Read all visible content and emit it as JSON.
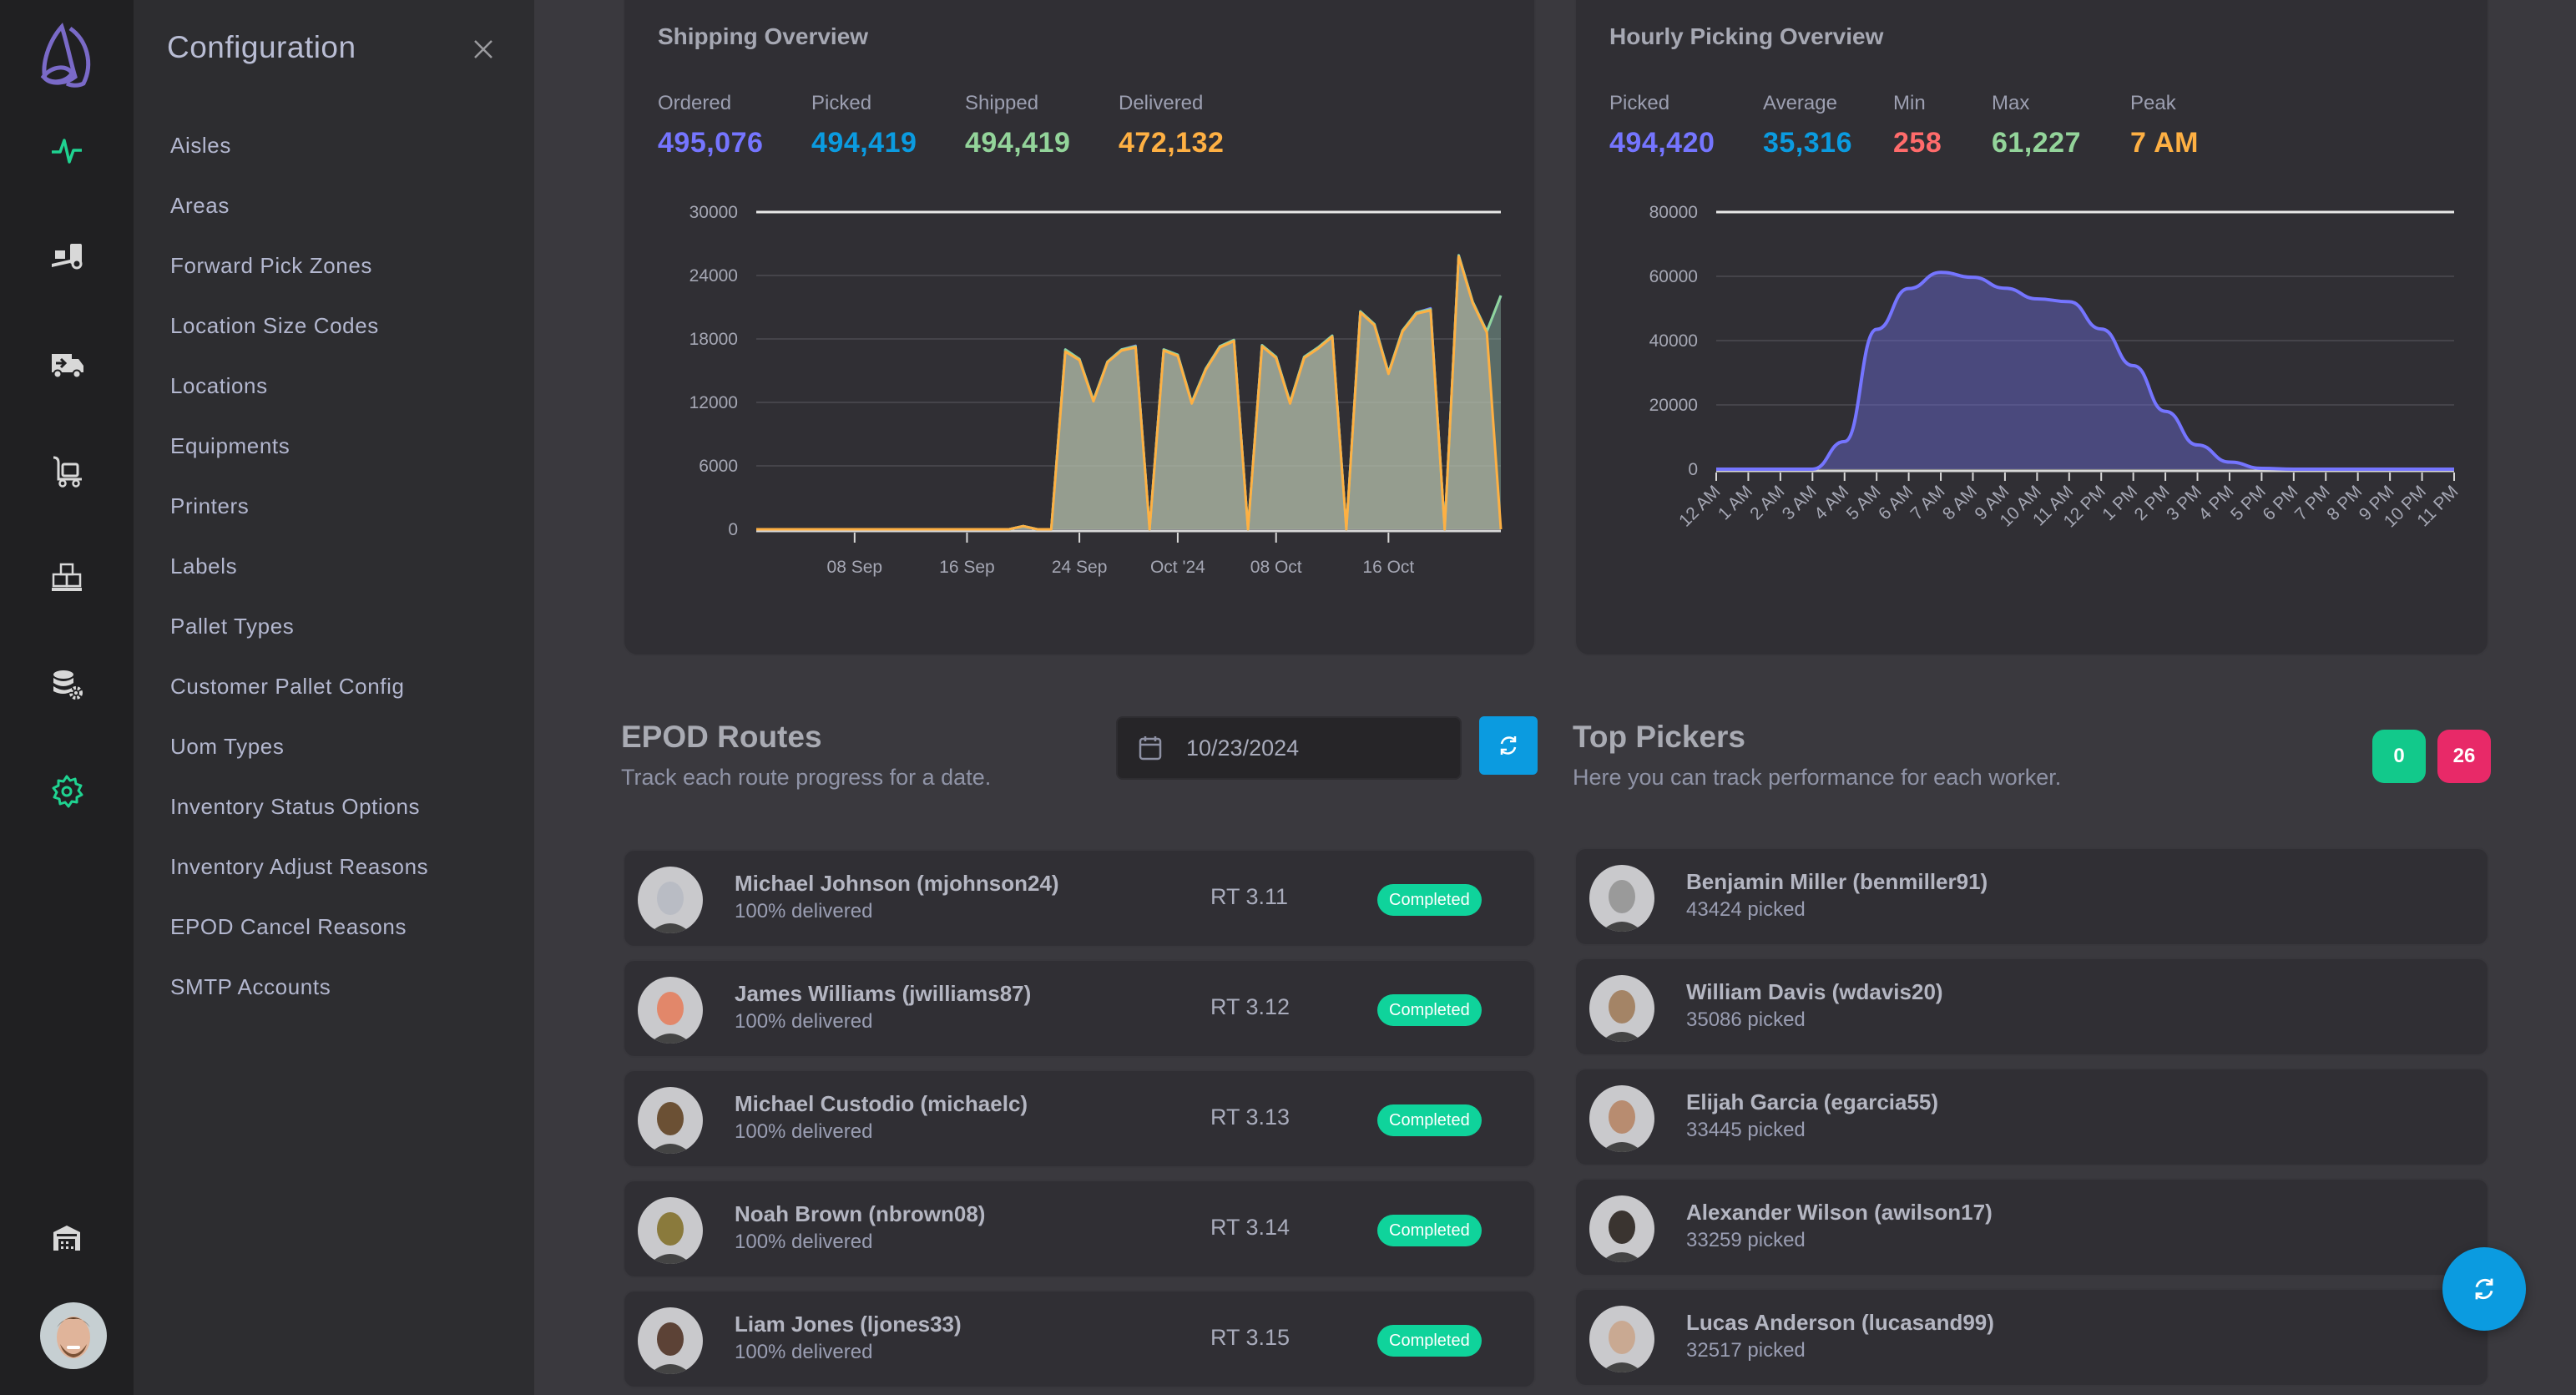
{
  "rail": {
    "items": [
      {
        "name": "dashboard",
        "icon": "activity-icon",
        "active": true
      },
      {
        "name": "receiving",
        "icon": "forklift-icon",
        "active": false
      },
      {
        "name": "shipping",
        "icon": "truck-icon",
        "active": false
      },
      {
        "name": "picking",
        "icon": "hand-cart-icon",
        "active": false
      },
      {
        "name": "inventory",
        "icon": "pallet-boxes-icon",
        "active": false
      },
      {
        "name": "data-settings",
        "icon": "database-gear-icon",
        "active": false
      },
      {
        "name": "configuration",
        "icon": "gear-icon",
        "active": true
      }
    ],
    "bottom": [
      {
        "name": "warehouse",
        "icon": "warehouse-icon"
      }
    ],
    "active_color": "#1fd391",
    "icon_color": "#d8d8d8"
  },
  "config": {
    "title": "Configuration",
    "items": [
      "Aisles",
      "Areas",
      "Forward Pick Zones",
      "Location Size Codes",
      "Locations",
      "Equipments",
      "Printers",
      "Labels",
      "Pallet Types",
      "Customer Pallet Config",
      "Uom Types",
      "Inventory Status Options",
      "Inventory Adjust Reasons",
      "EPOD Cancel Reasons",
      "SMTP Accounts"
    ]
  },
  "shipping": {
    "title": "Shipping Overview",
    "stats": [
      {
        "label": "Ordered",
        "value": "495,076",
        "color": "#7575ff"
      },
      {
        "label": "Picked",
        "value": "494,419",
        "color": "#0b9be0"
      },
      {
        "label": "Shipped",
        "value": "494,419",
        "color": "#93d49a"
      },
      {
        "label": "Delivered",
        "value": "472,132",
        "color": "#feb043"
      }
    ]
  },
  "hourly": {
    "title": "Hourly Picking Overview",
    "stats": [
      {
        "label": "Picked",
        "value": "494,420",
        "color": "#7575ff"
      },
      {
        "label": "Average",
        "value": "35,316",
        "color": "#0b9be0"
      },
      {
        "label": "Min",
        "value": "258",
        "color": "#ff6b6b"
      },
      {
        "label": "Max",
        "value": "61,227",
        "color": "#93d49a"
      },
      {
        "label": "Peak",
        "value": "7 AM",
        "color": "#feb043"
      }
    ]
  },
  "chart_data": [
    {
      "type": "area",
      "title": "Shipping Overview",
      "xlabel": "",
      "ylabel": "",
      "x_start": "2024-09-01",
      "x_end": "2024-10-24",
      "x_tick_labels": [
        "08 Sep",
        "16 Sep",
        "24 Sep",
        "Oct '24",
        "08 Oct",
        "16 Oct"
      ],
      "x_tick_days": [
        7,
        15,
        23,
        30,
        37,
        45
      ],
      "ylim": [
        0,
        30000
      ],
      "y_ticks": [
        0,
        6000,
        12000,
        18000,
        24000,
        30000
      ],
      "grid": true,
      "legend": "none",
      "series": [
        {
          "name": "Ordered",
          "color": "#7575ff",
          "values": [
            0,
            0,
            0,
            0,
            0,
            0,
            0,
            0,
            0,
            0,
            0,
            0,
            0,
            0,
            0,
            0,
            0,
            0,
            0,
            300,
            0,
            0,
            17000,
            16100,
            12200,
            15850,
            17000,
            17350,
            0,
            17000,
            16500,
            12000,
            15200,
            17300,
            17900,
            0,
            17400,
            16300,
            12000,
            16300,
            17200,
            18300,
            0,
            20600,
            19400,
            14800,
            18800,
            20500,
            20900,
            0,
            25900,
            21500,
            18700,
            22100
          ]
        },
        {
          "name": "Picked",
          "color": "#0b9be0",
          "values": [
            0,
            0,
            0,
            0,
            0,
            0,
            0,
            0,
            0,
            0,
            0,
            0,
            0,
            0,
            0,
            0,
            0,
            0,
            0,
            300,
            0,
            0,
            17000,
            16100,
            12200,
            15850,
            17000,
            17300,
            0,
            17000,
            16500,
            12000,
            15200,
            17300,
            17900,
            0,
            17400,
            16300,
            12000,
            16300,
            17200,
            18300,
            0,
            20600,
            19400,
            14800,
            18800,
            20500,
            20800,
            0,
            25900,
            21500,
            18700,
            22100
          ]
        },
        {
          "name": "Shipped",
          "color": "#93d49a",
          "values": [
            0,
            0,
            0,
            0,
            0,
            0,
            0,
            0,
            0,
            0,
            0,
            0,
            0,
            0,
            0,
            0,
            0,
            0,
            0,
            300,
            0,
            0,
            17000,
            16100,
            12200,
            15850,
            17000,
            17300,
            0,
            17000,
            16500,
            12000,
            15200,
            17300,
            17900,
            0,
            17400,
            16300,
            12000,
            16300,
            17200,
            18300,
            0,
            20600,
            19400,
            14800,
            18800,
            20500,
            20800,
            0,
            25900,
            21500,
            18700,
            22100
          ]
        },
        {
          "name": "Delivered",
          "color": "#feb043",
          "values": [
            0,
            0,
            0,
            0,
            0,
            0,
            0,
            0,
            0,
            0,
            0,
            0,
            0,
            0,
            0,
            0,
            0,
            0,
            0,
            300,
            0,
            0,
            16800,
            16000,
            12100,
            15800,
            16900,
            17200,
            0,
            16900,
            16400,
            11900,
            15100,
            17200,
            17800,
            0,
            17300,
            16200,
            11900,
            16200,
            17100,
            18200,
            0,
            20500,
            19300,
            14700,
            18700,
            20400,
            20700,
            0,
            25800,
            21400,
            18600,
            0
          ]
        }
      ]
    },
    {
      "type": "area",
      "title": "Hourly Picking Overview",
      "xlabel": "",
      "ylabel": "",
      "categories": [
        "12 AM",
        "1 AM",
        "2 AM",
        "3 AM",
        "4 AM",
        "5 AM",
        "6 AM",
        "7 AM",
        "8 AM",
        "9 AM",
        "10 AM",
        "11 AM",
        "12 PM",
        "1 PM",
        "2 PM",
        "3 PM",
        "4 PM",
        "5 PM",
        "6 PM",
        "7 PM",
        "8 PM",
        "9 PM",
        "10 PM",
        "11 PM"
      ],
      "ylim": [
        0,
        80000
      ],
      "y_ticks": [
        0,
        20000,
        40000,
        60000,
        80000
      ],
      "grid": true,
      "legend": "none",
      "series": [
        {
          "name": "Picked",
          "color": "#7575ff",
          "values": [
            0,
            0,
            0,
            0,
            8600,
            43500,
            56200,
            61227,
            59700,
            56300,
            53000,
            52100,
            43600,
            32200,
            18000,
            7535,
            2200,
            258,
            0,
            0,
            0,
            0,
            0,
            0
          ]
        }
      ]
    }
  ],
  "epod": {
    "title": "EPOD Routes",
    "subtitle": "Track each route progress for a date.",
    "date": "10/23/2024",
    "routes": [
      {
        "name": "Michael Johnson (mjohnson24)",
        "progress": "100% delivered",
        "route": "RT 3.11",
        "status": "Completed",
        "avatar_color": "#b9bcc4"
      },
      {
        "name": "James Williams (jwilliams87)",
        "progress": "100% delivered",
        "route": "RT 3.12",
        "status": "Completed",
        "avatar_color": "#e2876a"
      },
      {
        "name": "Michael Custodio (michaelc)",
        "progress": "100% delivered",
        "route": "RT 3.13",
        "status": "Completed",
        "avatar_color": "#6b5034"
      },
      {
        "name": "Noah Brown (nbrown08)",
        "progress": "100% delivered",
        "route": "RT 3.14",
        "status": "Completed",
        "avatar_color": "#8a7a3c"
      },
      {
        "name": "Liam Jones (ljones33)",
        "progress": "100% delivered",
        "route": "RT 3.15",
        "status": "Completed",
        "avatar_color": "#5c4236"
      }
    ],
    "status_color": "#0fd39b"
  },
  "pickers": {
    "title": "Top Pickers",
    "subtitle": "Here you can track performance for each worker.",
    "badges": [
      {
        "value": "0",
        "color": "#12c98b"
      },
      {
        "value": "26",
        "color": "#e82968"
      }
    ],
    "items": [
      {
        "name": "Benjamin Miller (benmiller91)",
        "picked": "43424 picked",
        "avatar_color": "#9a9a9a"
      },
      {
        "name": "William Davis (wdavis20)",
        "picked": "35086 picked",
        "avatar_color": "#a48466"
      },
      {
        "name": "Elijah Garcia (egarcia55)",
        "picked": "33445 picked",
        "avatar_color": "#b88c70"
      },
      {
        "name": "Alexander Wilson (awilson17)",
        "picked": "33259 picked",
        "avatar_color": "#3a3430"
      },
      {
        "name": "Lucas Anderson (lucasand99)",
        "picked": "32517 picked",
        "avatar_color": "#c9a992"
      }
    ]
  }
}
